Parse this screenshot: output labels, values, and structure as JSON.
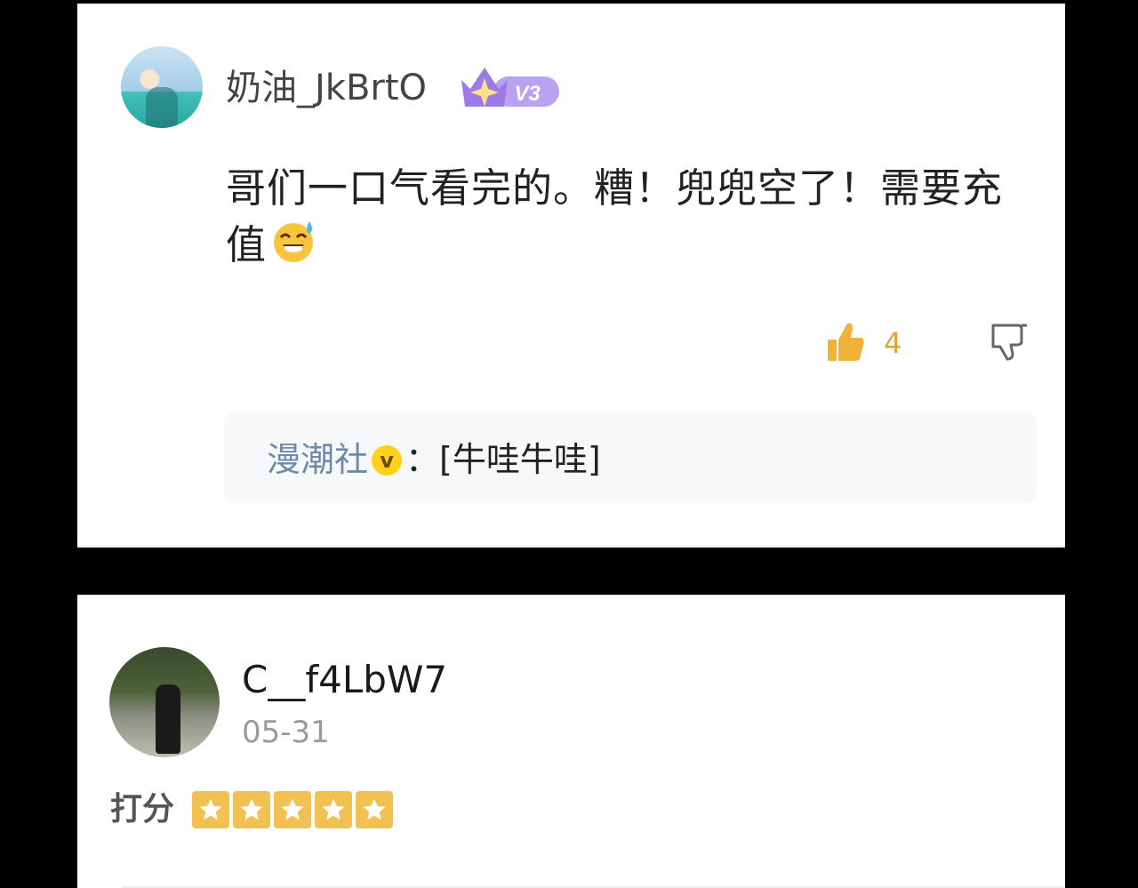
{
  "comment1": {
    "username": "奶油_JkBrtO",
    "level_badge": "V3",
    "text": "哥们一口气看完的。糟！兜兜空了！需要充值",
    "emoji_icon": "sweat-smile-emoji",
    "like_count": "4",
    "reply": {
      "author": "漫潮社",
      "verified_badge": "v",
      "separator": "：",
      "text": "[牛哇牛哇]"
    }
  },
  "comment2": {
    "username": "C__f4LbW7",
    "date": "05-31",
    "rating_label": "打分",
    "rating": 5
  },
  "colors": {
    "like": "#f0b33a",
    "reply_author": "#6d8aad",
    "star": "#f1c252",
    "badge": "#9c7be8"
  }
}
